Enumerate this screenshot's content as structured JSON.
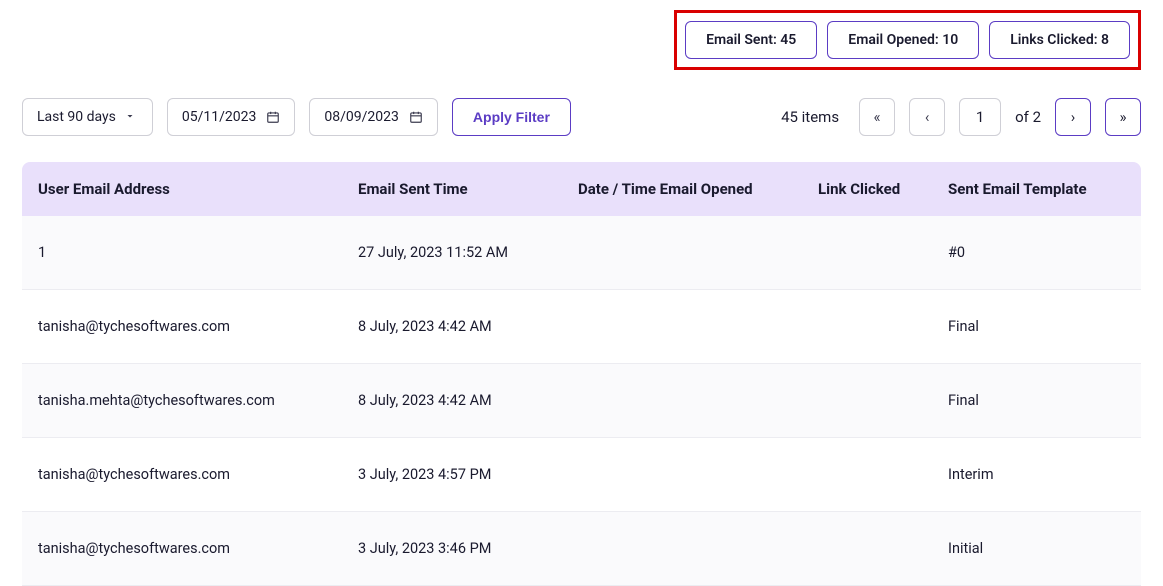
{
  "stats": {
    "email_sent": "Email Sent: 45",
    "email_opened": "Email Opened: 10",
    "links_clicked": "Links Clicked: 8"
  },
  "filters": {
    "range_label": "Last 90 days",
    "date_from": "05/11/2023",
    "date_to": "08/09/2023",
    "apply_label": "Apply Filter"
  },
  "pagination": {
    "items_text": "45 items",
    "first": "«",
    "prev": "‹",
    "current": "1",
    "of_text": "of 2",
    "next": "›",
    "last": "»"
  },
  "table": {
    "headers": {
      "email": "User Email Address",
      "sent": "Email Sent Time",
      "opened": "Date / Time Email Opened",
      "link": "Link Clicked",
      "template": "Sent Email Template"
    },
    "rows": [
      {
        "email": "1",
        "sent": "27 July, 2023 11:52 AM",
        "opened": "",
        "link": "",
        "template": "#0"
      },
      {
        "email": "tanisha@tychesoftwares.com",
        "sent": "8 July, 2023 4:42 AM",
        "opened": "",
        "link": "",
        "template": "Final"
      },
      {
        "email": "tanisha.mehta@tychesoftwares.com",
        "sent": "8 July, 2023 4:42 AM",
        "opened": "",
        "link": "",
        "template": "Final"
      },
      {
        "email": "tanisha@tychesoftwares.com",
        "sent": "3 July, 2023 4:57 PM",
        "opened": "",
        "link": "",
        "template": "Interim"
      },
      {
        "email": "tanisha@tychesoftwares.com",
        "sent": "3 July, 2023 3:46 PM",
        "opened": "",
        "link": "",
        "template": "Initial"
      }
    ]
  }
}
